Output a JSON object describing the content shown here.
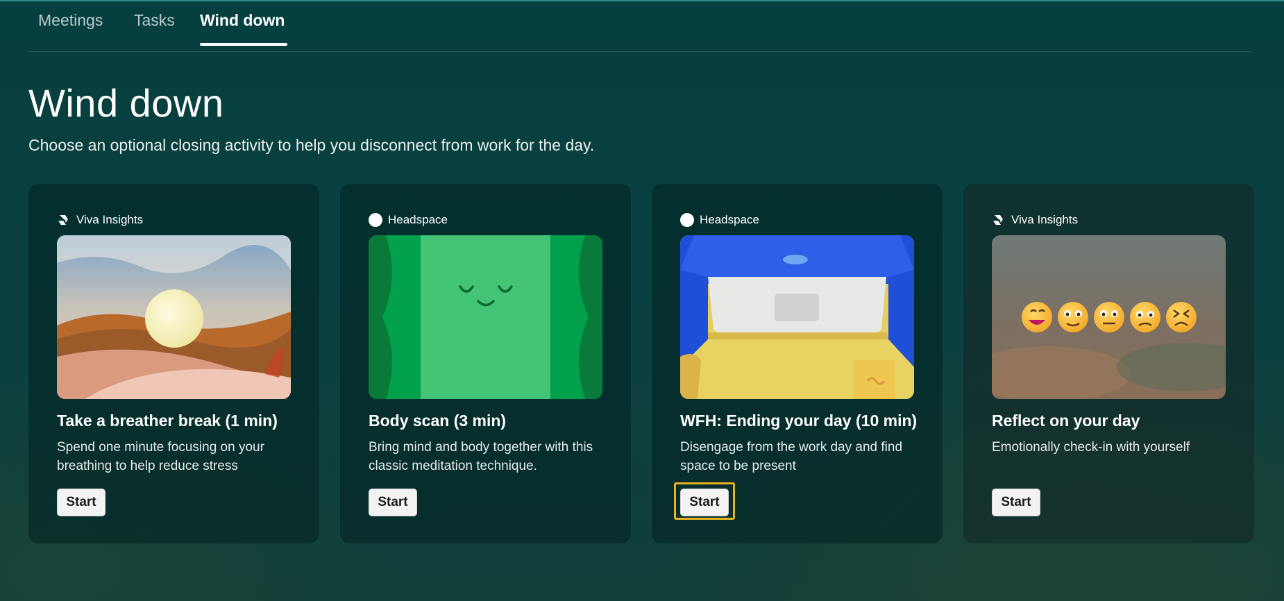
{
  "tabs": [
    {
      "label": "Meetings",
      "selected": false
    },
    {
      "label": "Tasks",
      "selected": false
    },
    {
      "label": "Wind down",
      "selected": true
    }
  ],
  "page": {
    "title": "Wind down",
    "subtitle": "Choose an optional closing activity to help you disconnect from work for the day."
  },
  "cards": [
    {
      "provider": "Viva Insights",
      "provider_icon": "viva-insights-icon",
      "title": "Take a breather break (1 min)",
      "description": "Spend one minute focusing on your breathing to help reduce stress",
      "button": "Start",
      "image": "desert-sunset-illustration"
    },
    {
      "provider": "Headspace",
      "provider_icon": "headspace-icon",
      "title": "Body scan (3 min)",
      "description": "Bring mind and body together with this classic meditation technique.",
      "button": "Start",
      "image": "smiling-character-illustration"
    },
    {
      "provider": "Headspace",
      "provider_icon": "headspace-icon",
      "title": "WFH: Ending your day (10 min)",
      "description": "Disengage from the work day and find space to be present",
      "button": "Start",
      "image": "laptop-closing-illustration",
      "focused": true
    },
    {
      "provider": "Viva Insights",
      "provider_icon": "viva-insights-icon",
      "title": "Reflect on your day",
      "description": "Emotionally check-in with yourself",
      "button": "Start",
      "image": "emoji-mood-illustration"
    }
  ],
  "colors": {
    "background": "#0a4040",
    "card": "#0b3434",
    "focus": "#e8b21f",
    "headspace_green": "#00a04c"
  }
}
